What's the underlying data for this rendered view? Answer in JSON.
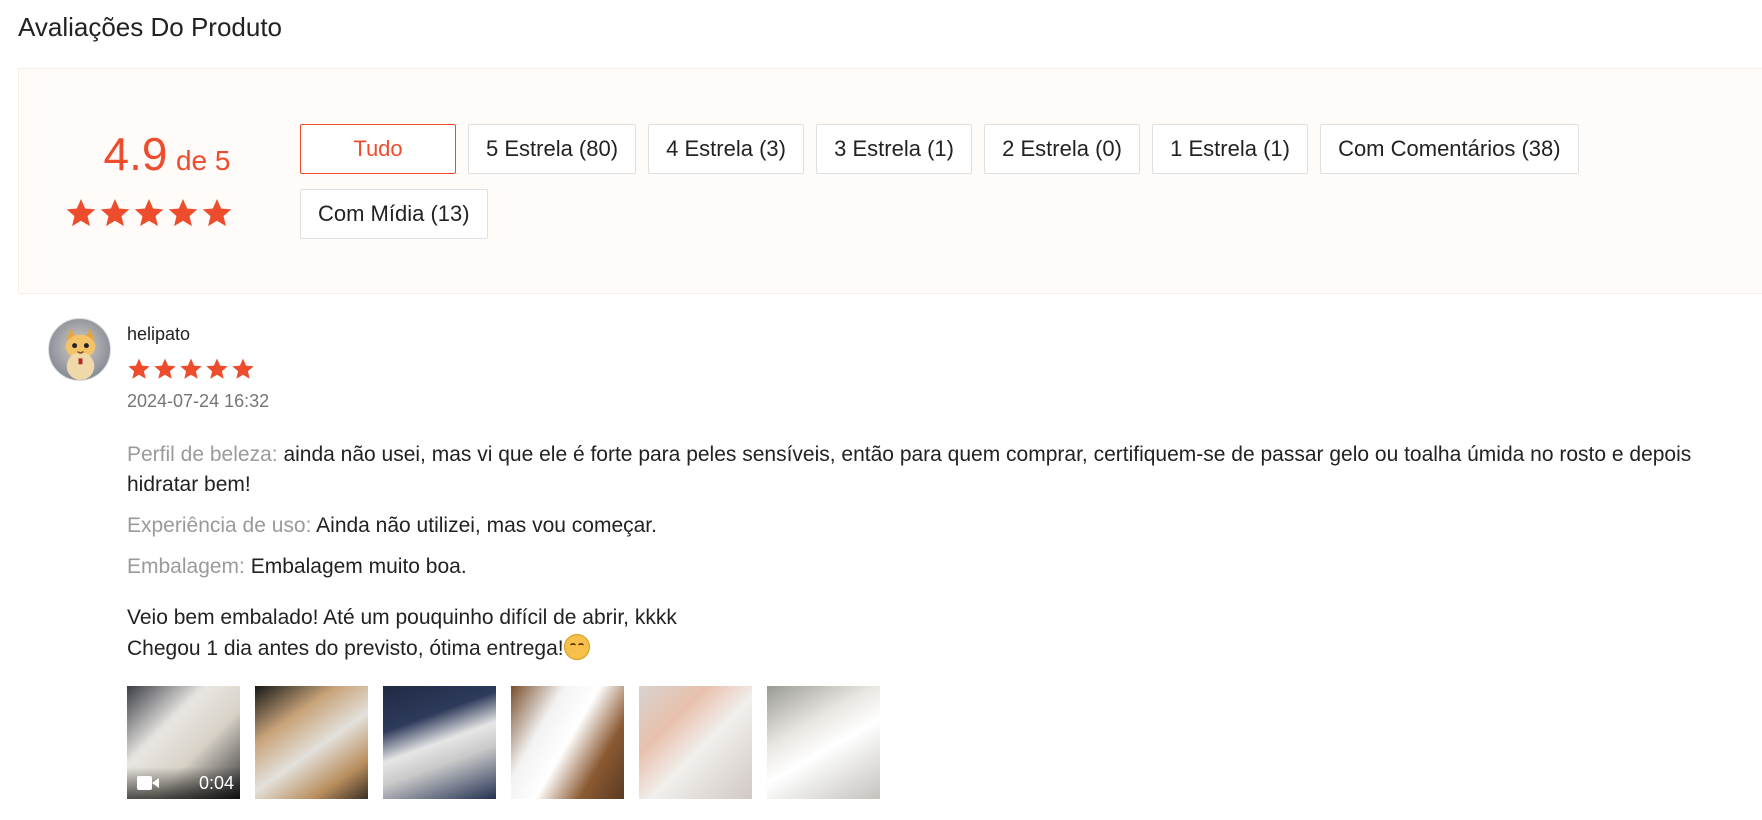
{
  "section_title": "Avaliações Do Produto",
  "overview": {
    "rating": "4.9",
    "rating_of": "de 5",
    "stars": 5,
    "accent_color": "#ee4d2d"
  },
  "filters": [
    {
      "label": "Tudo",
      "active": true
    },
    {
      "label": "5 Estrela (80)",
      "active": false
    },
    {
      "label": "4 Estrela (3)",
      "active": false
    },
    {
      "label": "3 Estrela (1)",
      "active": false
    },
    {
      "label": "2 Estrela (0)",
      "active": false
    },
    {
      "label": "1 Estrela (1)",
      "active": false
    },
    {
      "label": "Com Comentários (38)",
      "active": false
    },
    {
      "label": "Com Mídia (13)",
      "active": false
    }
  ],
  "review": {
    "avatar_icon": "cat-avatar",
    "username": "helipato",
    "stars": 5,
    "date": "2024-07-24 16:32",
    "fields": [
      {
        "label": "Perfil de beleza:",
        "value": "ainda não usei, mas vi que ele é forte para peles sensíveis, então para quem comprar, certifiquem-se de passar gelo ou toalha úmida no rosto e depois hidratar bem!"
      },
      {
        "label": "Experiência de uso:",
        "value": "Ainda não utilizei, mas vou começar."
      },
      {
        "label": "Embalagem:",
        "value": "Embalagem muito boa."
      }
    ],
    "comment_line_1": "Veio bem embalado! Até um pouquinho difícil de abrir, kkkk",
    "comment_line_2": "Chegou 1 dia antes do previsto, ótima entrega!",
    "comment_emoji": "smiling-face-emoji",
    "media": [
      {
        "type": "video",
        "duration": "0:04"
      },
      {
        "type": "image"
      },
      {
        "type": "image"
      },
      {
        "type": "image"
      },
      {
        "type": "image"
      },
      {
        "type": "image"
      }
    ]
  }
}
